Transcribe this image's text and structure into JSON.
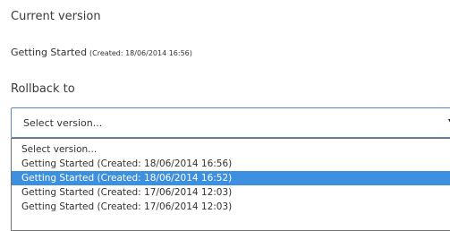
{
  "current": {
    "label": "Current version",
    "name": "Getting Started",
    "created": "(Created: 18/06/2014 16:56)"
  },
  "rollback": {
    "label": "Rollback to",
    "select": {
      "value": "Select version...",
      "options": [
        "Select version...",
        "Getting Started (Created: 18/06/2014 16:56)",
        "Getting Started (Created: 18/06/2014 16:52)",
        "Getting Started (Created: 17/06/2014 12:03)",
        "Getting Started (Created: 17/06/2014 12:03)"
      ],
      "highlighted_index": 2,
      "highlight_color": "#3d8fe0",
      "border_color": "#5b84c4"
    }
  },
  "icons": {
    "dropdown_arrow": "chevron-down-icon"
  }
}
